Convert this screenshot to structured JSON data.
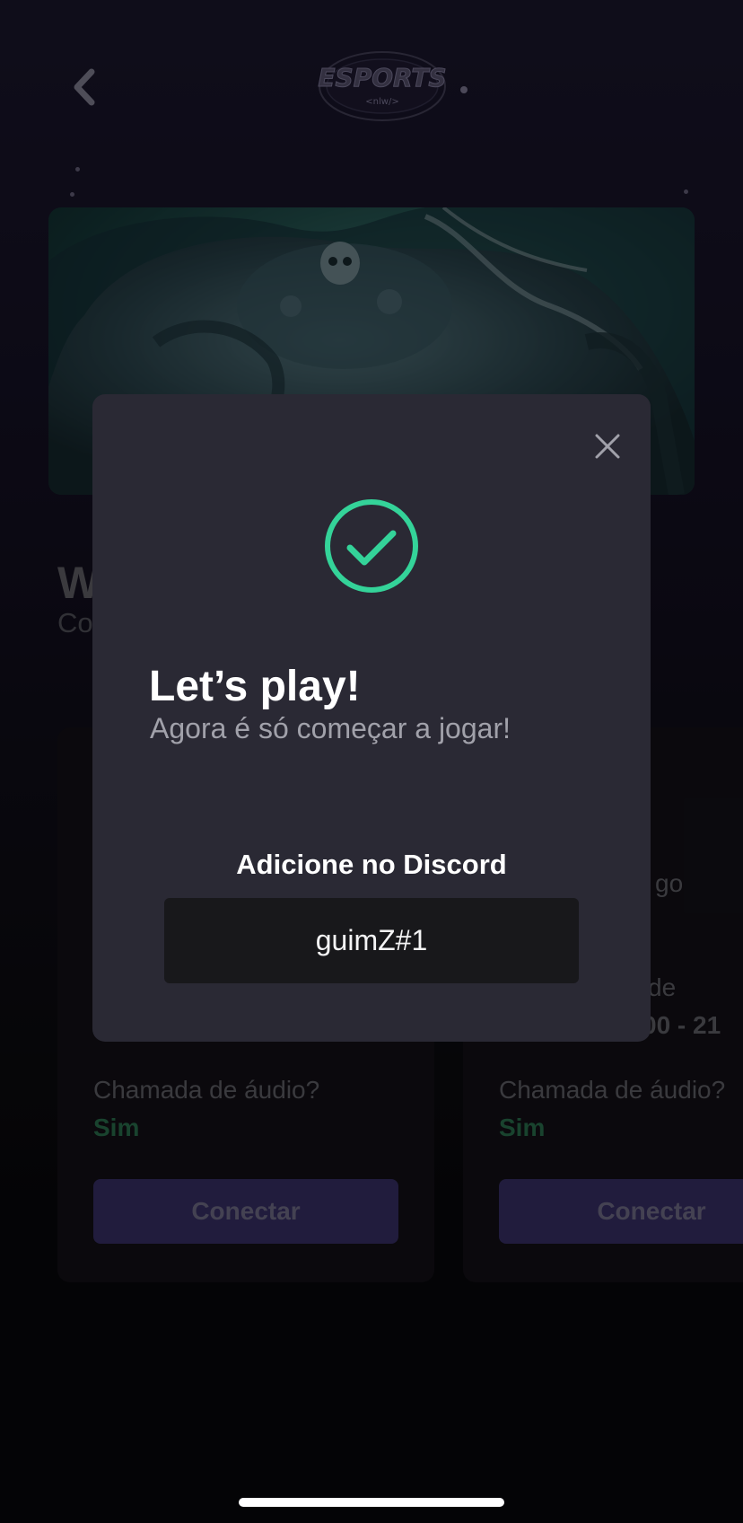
{
  "header": {
    "logo_text": "ESPORTS",
    "logo_subtext": "<nlw/>"
  },
  "game": {
    "title_fragment": "W",
    "subtitle_fragment": "Co"
  },
  "cards": [
    {
      "audio_label": "Chamada de áudio?",
      "audio_value": "Sim",
      "connect_label": "Conectar"
    },
    {
      "fragment_1": "go",
      "fragment_2": "de",
      "fragment_3": "00 - 21",
      "audio_label": "Chamada de áudio?",
      "audio_value": "Sim",
      "connect_label": "Conectar"
    }
  ],
  "modal": {
    "title": "Let’s play!",
    "subtitle": "Agora é só começar a jogar!",
    "discord_label": "Adicione no Discord",
    "discord_user": "guimZ#1"
  },
  "colors": {
    "accent": "#8b5cf6",
    "success": "#34d399",
    "modal_bg": "#2a2934"
  },
  "icons": {
    "back": "chevron-left-icon",
    "close": "close-icon",
    "check": "check-circle-icon"
  }
}
